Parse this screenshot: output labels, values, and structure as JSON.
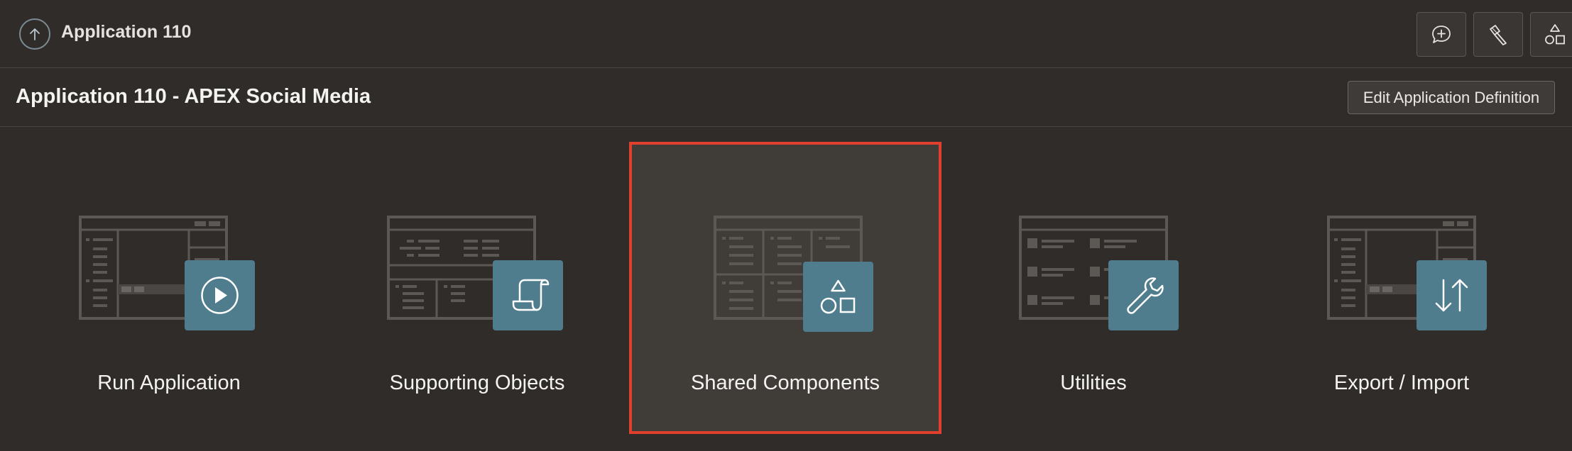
{
  "topbar": {
    "title": "Application 110",
    "buttons": [
      {
        "name": "feedback",
        "icon": "chat-plus-icon"
      },
      {
        "name": "utilities",
        "icon": "flashlight-icon"
      },
      {
        "name": "shared-components",
        "icon": "shapes-icon"
      }
    ]
  },
  "header": {
    "title": "Application 110 - APEX Social Media",
    "edit_button_label": "Edit Application Definition"
  },
  "cards": [
    {
      "label": "Run Application",
      "icon": "play-icon",
      "selected": false
    },
    {
      "label": "Supporting Objects",
      "icon": "scroll-icon",
      "selected": false
    },
    {
      "label": "Shared Components",
      "icon": "shapes-icon",
      "selected": true
    },
    {
      "label": "Utilities",
      "icon": "wrench-icon",
      "selected": false
    },
    {
      "label": "Export / Import",
      "icon": "arrows-up-down-icon",
      "selected": false
    }
  ],
  "colors": {
    "background": "#2f2c2a",
    "icon_tile": "#4f7d8d",
    "selection_border": "#e0402d"
  }
}
